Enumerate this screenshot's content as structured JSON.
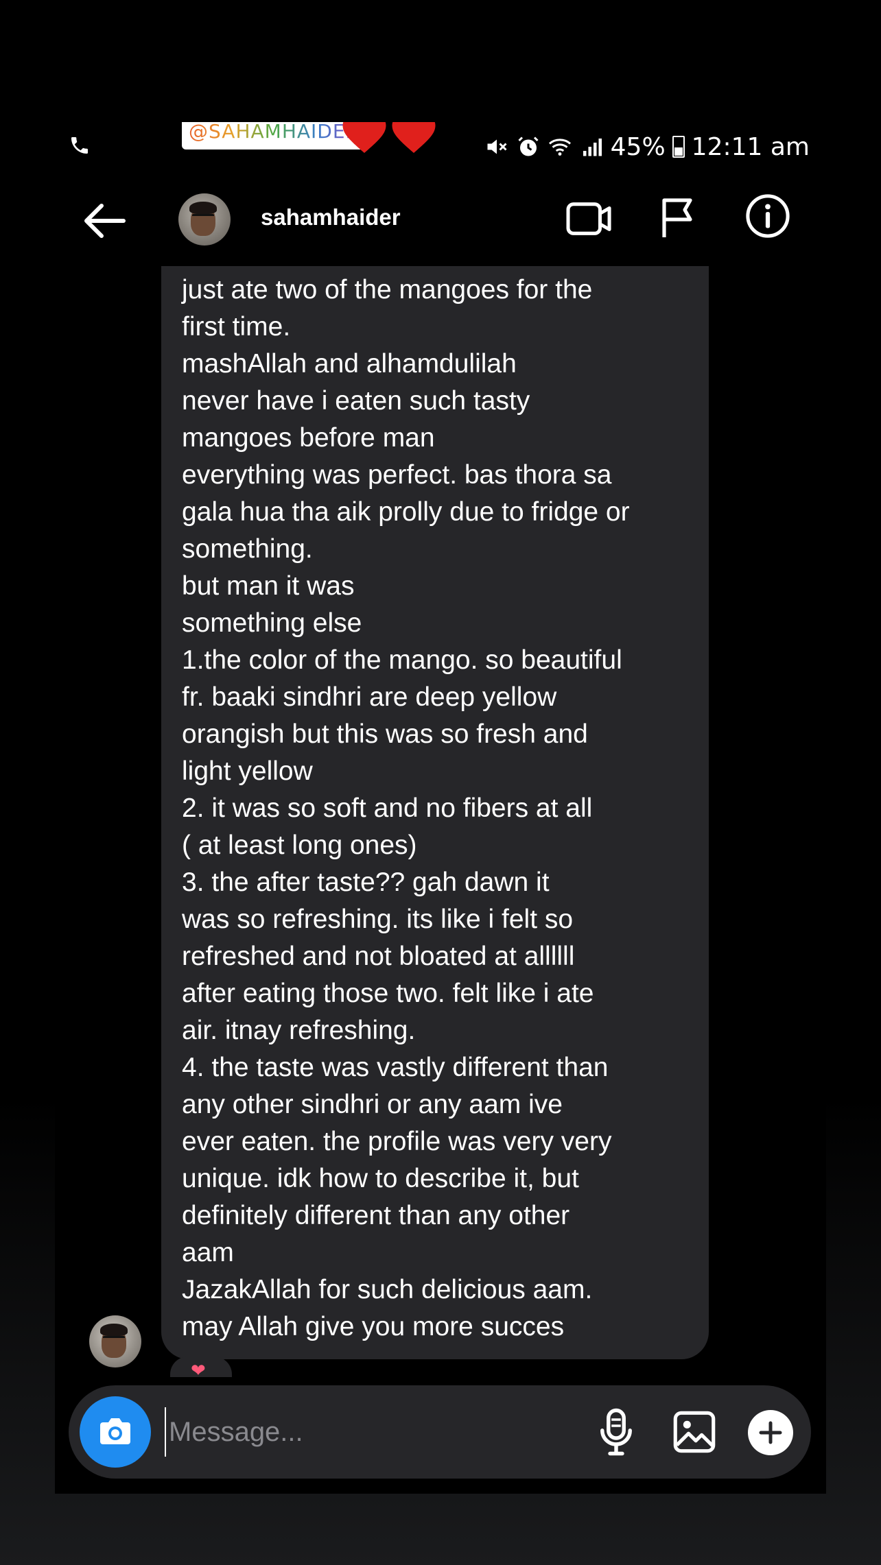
{
  "story_overlay": {
    "mention_tag": "@SAHAMHAIDER",
    "hearts_emoji": "❤️❤️"
  },
  "status_bar": {
    "battery": "45%",
    "time": "12:11 am",
    "icons": [
      "phone-icon",
      "mute-icon",
      "alarm-icon",
      "wifi-icon",
      "signal-icon",
      "battery-icon"
    ]
  },
  "header": {
    "username": "sahamhaider",
    "icons": [
      "back-arrow-icon",
      "video-call-icon",
      "flag-icon",
      "info-icon"
    ]
  },
  "message": {
    "text": "just ate two of the mangoes for the\nfirst time.\nmashAllah and alhamdulilah\nnever have i eaten such tasty\nmangoes before man\neverything was perfect. bas thora sa\ngala hua tha aik prolly due to fridge or\nsomething.\nbut man it was\nsomething else\n1.the color of the mango. so beautiful\nfr. baaki sindhri are deep yellow\norangish but this was so fresh and\nlight yellow\n2. it was so soft and no fibers at all\n( at least long ones)\n3. the after taste?? gah dawn it\nwas so refreshing. its like i felt so\nrefreshed and not bloated at allllll\nafter eating those two. felt like i ate\nair. itnay refreshing.\n4. the taste was vastly different than\nany other sindhri or any aam ive\never eaten. the profile was very very\nunique. idk how to describe it, but\ndefinitely different than any other\naam\nJazakAllah for such delicious aam.\nmay Allah give you more succes",
    "reaction": "❤"
  },
  "composer": {
    "placeholder": "Message...",
    "icons": [
      "camera-icon",
      "microphone-icon",
      "gallery-icon",
      "add-icon"
    ]
  },
  "colors": {
    "background": "#000000",
    "bubble": "#262629",
    "camera_button": "#1f8cf0",
    "text": "#ffffff",
    "placeholder": "#8a8a8f"
  }
}
